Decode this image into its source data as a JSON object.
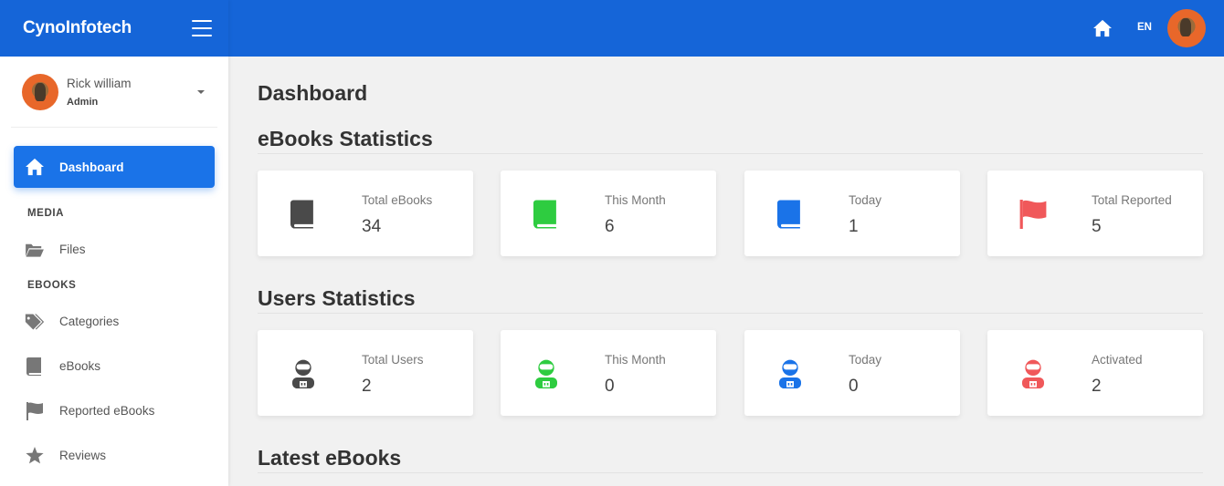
{
  "brand": "CynoInfotech",
  "user": {
    "name": "Rick william",
    "role": "Admin"
  },
  "sidebar": {
    "active": {
      "label": "Dashboard",
      "icon": "home-icon"
    },
    "sections": [
      {
        "title": "MEDIA",
        "items": [
          {
            "label": "Files",
            "icon": "folder-icon"
          }
        ]
      },
      {
        "title": "EBOOKS",
        "items": [
          {
            "label": "Categories",
            "icon": "tags-icon"
          },
          {
            "label": "eBooks",
            "icon": "book-icon"
          },
          {
            "label": "Reported eBooks",
            "icon": "flag-icon"
          },
          {
            "label": "Reviews",
            "icon": "star-icon"
          }
        ]
      }
    ]
  },
  "topbar": {
    "lang": "EN"
  },
  "page_title": "Dashboard",
  "ebooks_stats": {
    "title": "eBooks Statistics",
    "cards": [
      {
        "label": "Total eBooks",
        "value": "34",
        "color": "#4a4a4a",
        "icon": "book-icon"
      },
      {
        "label": "This Month",
        "value": "6",
        "color": "#2ecc40",
        "icon": "book-icon"
      },
      {
        "label": "Today",
        "value": "1",
        "color": "#1a73e8",
        "icon": "book-icon"
      },
      {
        "label": "Total Reported",
        "value": "5",
        "color": "#f0585a",
        "icon": "flag-icon"
      }
    ]
  },
  "users_stats": {
    "title": "Users Statistics",
    "cards": [
      {
        "label": "Total Users",
        "value": "2",
        "color": "#4a4a4a",
        "icon": "user-astronaut-icon"
      },
      {
        "label": "This Month",
        "value": "0",
        "color": "#2ecc40",
        "icon": "user-astronaut-icon"
      },
      {
        "label": "Today",
        "value": "0",
        "color": "#1a73e8",
        "icon": "user-astronaut-icon"
      },
      {
        "label": "Activated",
        "value": "2",
        "color": "#f0585a",
        "icon": "user-astronaut-icon"
      }
    ]
  },
  "latest_ebooks": {
    "title": "Latest eBooks"
  }
}
